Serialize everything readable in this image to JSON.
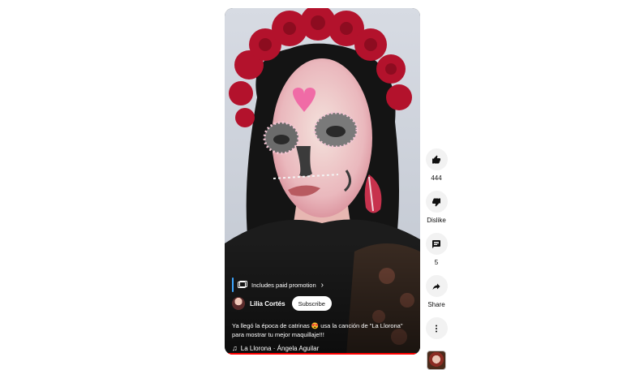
{
  "video": {
    "paid_promotion": "Includes paid promotion",
    "channel_name": "Lilia Cortés",
    "subscribe_label": "Subscribe",
    "description": "Ya llegó la época de catrinas 😍 usa la canción de \"La Llorona\" para mostrar tu mejor maquillaje!!!",
    "song": "La Llorona · Ángela Aguilar",
    "progress": 0.98
  },
  "actions": {
    "like_count": "444",
    "dislike_label": "Dislike",
    "comment_count": "5",
    "share_label": "Share"
  },
  "icons": {
    "like": "thumbs-up-icon",
    "dislike": "thumbs-down-icon",
    "comment": "comment-icon",
    "share": "share-icon",
    "more": "more-vertical-icon",
    "music": "music-note-icon"
  },
  "colors": {
    "progress": "#ff0000",
    "promo_accent": "#3ea6ff"
  }
}
